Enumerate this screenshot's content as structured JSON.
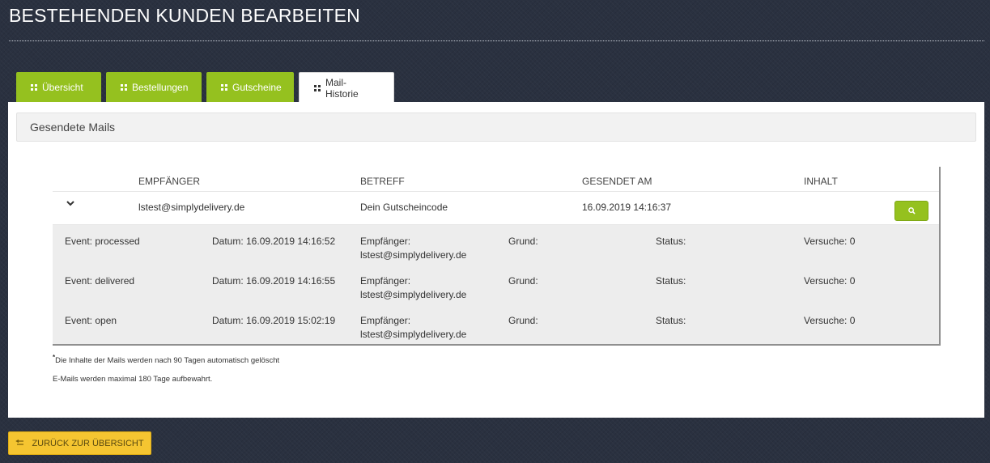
{
  "page": {
    "title": "BESTEHENDEN KUNDEN BEARBEITEN"
  },
  "tabs": [
    {
      "label": "Übersicht",
      "icon": "grid-icon",
      "active": false
    },
    {
      "label": "Bestellungen",
      "icon": "grid-icon",
      "active": false
    },
    {
      "label": "Gutscheine",
      "icon": "grid-icon",
      "active": false
    },
    {
      "label": "Mail-Historie",
      "icon": "grid-icon",
      "active": true
    }
  ],
  "section": {
    "title": "Gesendete Mails"
  },
  "table": {
    "headers": [
      "EMPFÄNGER",
      "BETREFF",
      "GESENDET AM",
      "INHALT"
    ],
    "mail": {
      "recipient": "lstest@simplydelivery.de",
      "subject": "Dein Gutscheincode",
      "sent_at": "16.09.2019 14:16:37",
      "expand_icon": "chevron-down-icon",
      "content_icon": "search-icon"
    },
    "events": [
      {
        "event": "Event: processed",
        "datum": "Datum: 16.09.2019 14:16:52",
        "empfaenger_label": "Empfänger:",
        "empfaenger": "lstest@simplydelivery.de",
        "grund": "Grund:",
        "status": "Status:",
        "versuche": "Versuche: 0"
      },
      {
        "event": "Event: delivered",
        "datum": "Datum: 16.09.2019 14:16:55",
        "empfaenger_label": "Empfänger:",
        "empfaenger": "lstest@simplydelivery.de",
        "grund": "Grund:",
        "status": "Status:",
        "versuche": "Versuche: 0"
      },
      {
        "event": "Event: open",
        "datum": "Datum: 16.09.2019 15:02:19",
        "empfaenger_label": "Empfänger:",
        "empfaenger": "lstest@simplydelivery.de",
        "grund": "Grund:",
        "status": "Status:",
        "versuche": "Versuche: 0"
      }
    ]
  },
  "notes": {
    "asterisk": "*",
    "retention_content": "Die Inhalte der Mails werden nach 90 Tagen automatisch gelöscht",
    "retention_mails": "E-Mails werden maximal 180 Tage aufbewahrt."
  },
  "back_button": {
    "label": "ZURÜCK ZUR ÜBERSICHT",
    "icon": "back-arrow-icon"
  },
  "colors": {
    "background": "#2a3140",
    "tab_green": "#95c11f",
    "button_yellow": "#f5c531",
    "section_bg": "#f2f2f2",
    "events_bg": "#ededed"
  }
}
